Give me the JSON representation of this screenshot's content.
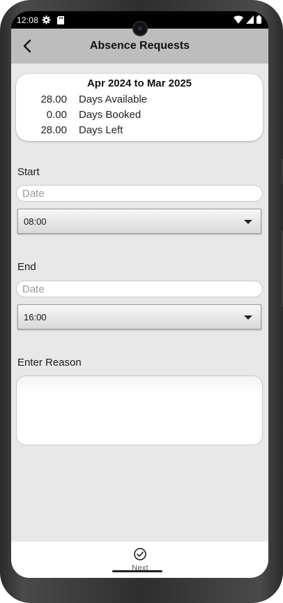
{
  "status_bar": {
    "time": "12:08"
  },
  "app_bar": {
    "title": "Absence Requests"
  },
  "summary": {
    "period": "Apr 2024 to Mar 2025",
    "rows": [
      {
        "value": "28.00",
        "label": "Days Available"
      },
      {
        "value": "0.00",
        "label": "Days Booked"
      },
      {
        "value": "28.00",
        "label": "Days Left"
      }
    ]
  },
  "start": {
    "label": "Start",
    "date_placeholder": "Date",
    "date_value": "",
    "time_value": "08:00"
  },
  "end": {
    "label": "End",
    "date_placeholder": "Date",
    "date_value": "",
    "time_value": "16:00"
  },
  "reason": {
    "label": "Enter Reason",
    "value": ""
  },
  "bottom_bar": {
    "next_label": "Next"
  },
  "icons": {
    "back": "chevron-left-icon",
    "next": "check-circle-icon",
    "dropdown": "caret-down-icon"
  },
  "colors": {
    "app_bar": "#bdbdbd",
    "background": "#e8e8e8",
    "card": "#ffffff"
  }
}
